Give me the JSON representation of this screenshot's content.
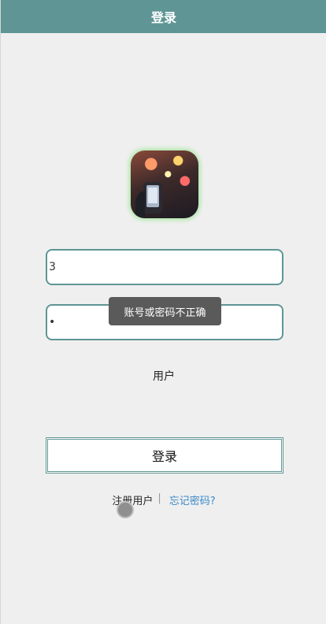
{
  "header": {
    "title": "登录"
  },
  "form": {
    "username_value": "3",
    "password_value": "•",
    "role_label": "用户",
    "login_label": "登录"
  },
  "toast": {
    "message": "账号或密码不正确"
  },
  "links": {
    "register": "注册用户",
    "separator": "|",
    "forgot": "忘记密码?"
  },
  "colors": {
    "header": "#5f9595",
    "link": "#3a88c8",
    "glow": "#a8e6a0"
  },
  "icons": {
    "avatar": "app-logo-image"
  }
}
